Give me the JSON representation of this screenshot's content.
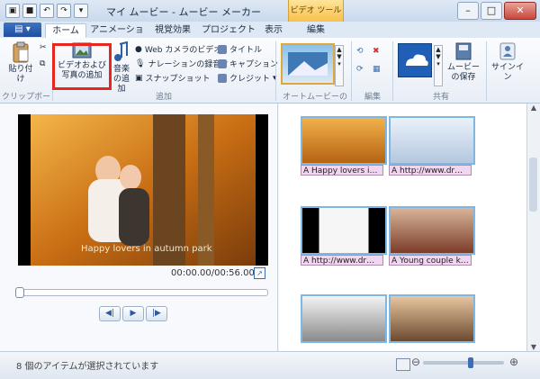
{
  "app": {
    "title": "マイ ムービー - ムービー メーカー",
    "video_tools": "ビデオ ツール"
  },
  "tabs": {
    "home": "ホーム",
    "animations": "アニメーション",
    "visual_effects": "視覚効果",
    "project": "プロジェクト",
    "view": "表示",
    "edit": "編集"
  },
  "ribbon": {
    "paste": "貼り付け",
    "clipboard": "クリップボード",
    "add_videos": "ビデオおよび写真の追加",
    "add_music": "音楽の追加",
    "webcam": "Web カメラのビデオ",
    "narration": "ナレーションの録音",
    "snapshot": "スナップショット",
    "title": "タイトル",
    "caption": "キャプション",
    "credits": "クレジット",
    "add_group": "追加",
    "auto_movie": "オートムービーのテーマ",
    "editing": "編集",
    "save_movie": "ムービーの保存",
    "share": "共有",
    "signin": "サインイン"
  },
  "preview": {
    "overlay_text": "Happy lovers in autumn park",
    "time": "00:00.00/00:56.00"
  },
  "storyboard": {
    "captions": [
      "A Happy lovers i…",
      "A http://www.dr…",
      "A http://www.dr…",
      "A Young couple k…"
    ]
  },
  "status": {
    "text": "8 個のアイテムが選択されています"
  }
}
